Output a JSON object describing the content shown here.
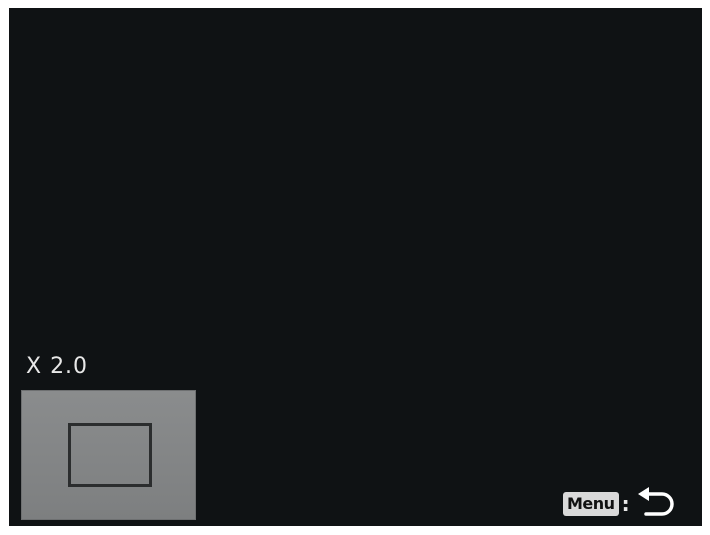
{
  "playback": {
    "zoom_level": "X 2.0",
    "zoom_ratio": 2.0
  },
  "navigator": {
    "thumbnail_color": "#848687",
    "viewport_frame_color": "#2b2d2e"
  },
  "hint": {
    "menu_key_label": "Menu",
    "separator": ":",
    "action_icon": "return-icon"
  },
  "colors": {
    "screen_background": "#0f1214",
    "text": "#e8e8e8"
  }
}
